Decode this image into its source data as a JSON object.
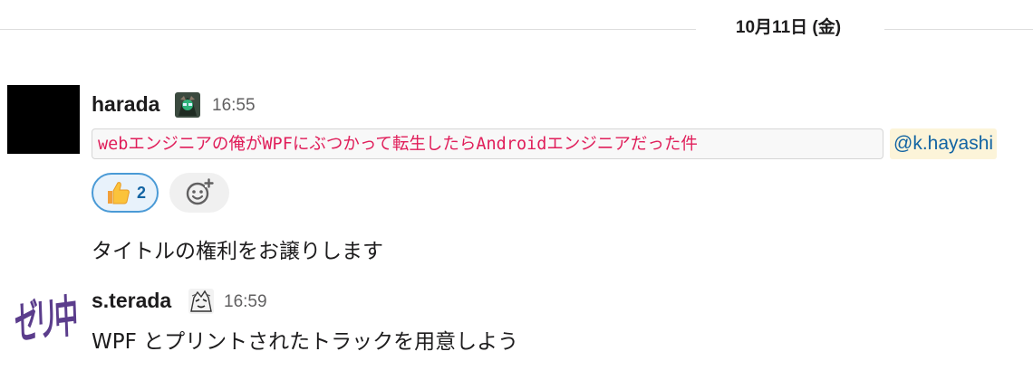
{
  "date_divider": {
    "label": "10月11日 (金)"
  },
  "messages": [
    {
      "author": "harada",
      "time": "16:55",
      "code_text": "webエンジニアの俺がWPFにぶつかって転生したらAndroidエンジニアだった件",
      "mention": "@k.hayashi",
      "reactions": [
        {
          "emoji": "thumbs-up",
          "count": "2"
        }
      ]
    },
    {
      "text": "タイトルの権利をお譲りします"
    },
    {
      "author": "s.terada",
      "avatar_text": "ゼリ中",
      "time": "16:59",
      "text": "WPF とプリントされたトラックを用意しよう"
    }
  ],
  "colors": {
    "accent": "#1264a3",
    "code": "#e01e5a",
    "mention_bg": "#fcf4d9",
    "zeri": "#5b3d8c"
  }
}
